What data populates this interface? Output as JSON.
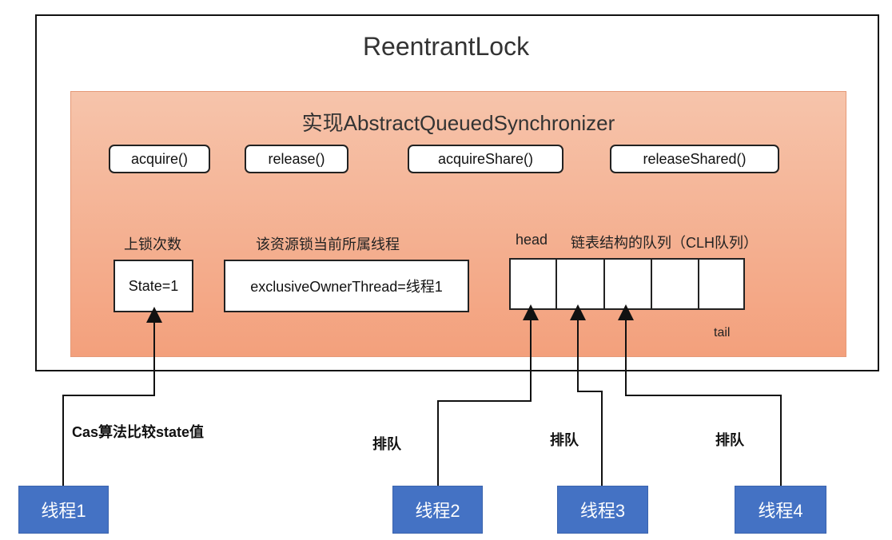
{
  "title": "ReentrantLock",
  "aqs": {
    "title": "实现AbstractQueuedSynchronizer",
    "methods": [
      "acquire()",
      "release()",
      "acquireShare()",
      "releaseShared()"
    ]
  },
  "state": {
    "label": "上锁次数",
    "value": "State=1"
  },
  "owner": {
    "label": "该资源锁当前所属线程",
    "value": "exclusiveOwnerThread=线程1"
  },
  "queue": {
    "head_label": "head",
    "label": "链表结构的队列（CLH队列）",
    "tail_label": "tail",
    "cells": 5
  },
  "annotations": {
    "cas": "Cas算法比较state值",
    "queue": [
      "排队",
      "排队",
      "排队"
    ]
  },
  "threads": [
    "线程1",
    "线程2",
    "线程3",
    "线程4"
  ]
}
